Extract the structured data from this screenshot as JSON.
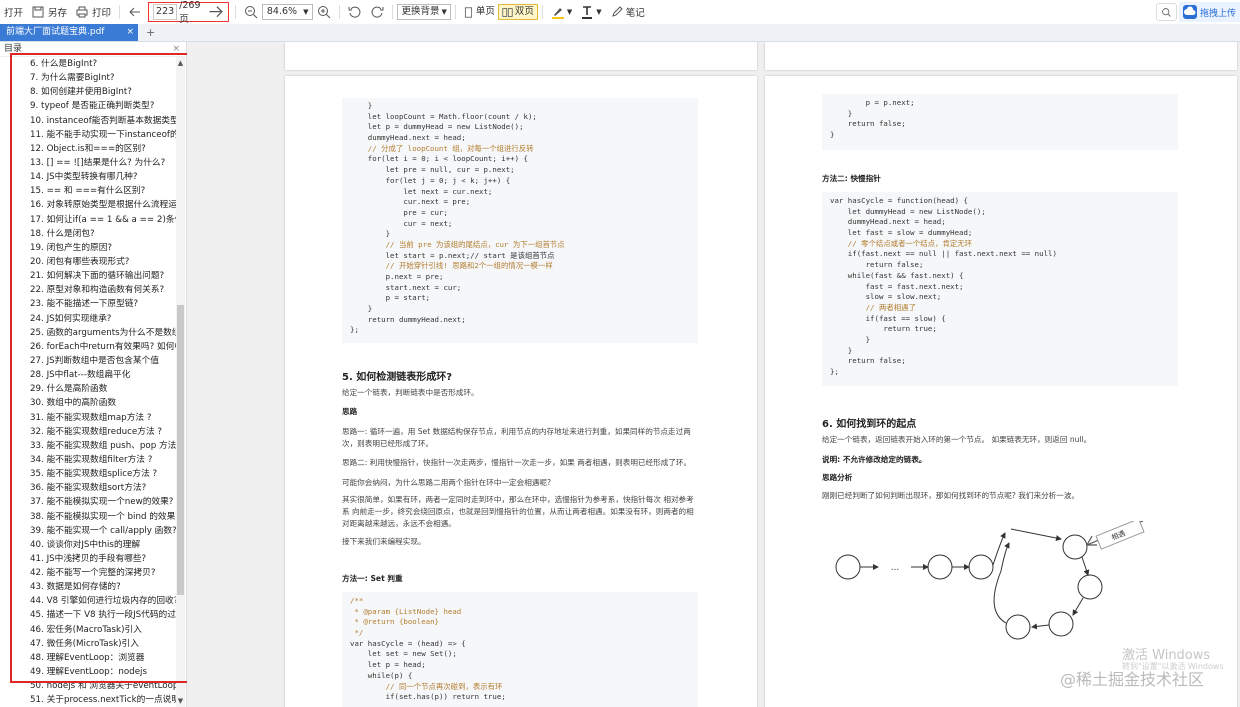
{
  "toolbar": {
    "open": "打开",
    "save_as": "另存",
    "print": "打印",
    "page_current": "223",
    "page_total": "/269页",
    "zoom": "84.6%",
    "background": "更换背景",
    "single": "单页",
    "double": "双页",
    "notes": "笔记",
    "upload": "拖拽上传"
  },
  "tab": {
    "title": "前端大厂面试题宝典.pdf"
  },
  "sidebar": {
    "title": "目录",
    "items": [
      "6. 什么是BigInt?",
      "7. 为什么需要BigInt?",
      "8. 如何创建并使用BigInt?",
      "9. typeof 是否能正确判断类型?",
      "10. instanceof能否判断基本数据类型",
      "11. 能不能手动实现一下instanceof的",
      "12. Object.is和===的区别?",
      "13. [] == ![]结果是什么? 为什么?",
      "14. JS中类型转换有哪几种?",
      "15. == 和 ===有什么区别?",
      "16. 对象转原始类型是根据什么流程运",
      "17. 如何让if(a == 1 && a == 2)条件",
      "18. 什么是闭包?",
      "19. 闭包产生的原因?",
      "20. 闭包有哪些表现形式?",
      "21. 如何解决下面的循环输出问题?",
      "22. 原型对象和构造函数有何关系?",
      "23. 能不能描述一下原型链?",
      "24. JS如何实现继承?",
      "25. 函数的arguments为什么不是数组",
      "26. forEach中return有效果吗? 如何中",
      "27. JS判断数组中是否包含某个值",
      "28. JS中flat---数组扁平化",
      "29. 什么是高阶函数",
      "30. 数组中的高阶函数",
      "31. 能不能实现数组map方法 ?",
      "32. 能不能实现数组reduce方法 ?",
      "33. 能不能实现数组 push、pop 方法",
      "34. 能不能实现数组filter方法 ?",
      "35. 能不能实现数组splice方法 ?",
      "36. 能不能实现数组sort方法?",
      "37. 能不能模拟实现一个new的效果?",
      "38. 能不能模拟实现一个 bind 的效果?",
      "39. 能不能实现一个 call/apply 函数?",
      "40. 谈谈你对JS中this的理解",
      "41. JS中浅拷贝的手段有哪些?",
      "42. 能不能写一个完整的深拷贝?",
      "43. 数据是如何存储的?",
      "44. V8 引擎如何进行垃圾内存的回收?",
      "45. 描述一下 V8 执行一段JS代码的过程",
      "46. 宏任务(MacroTask)引入",
      "47. 微任务(MicroTask)引入",
      "48. 理解EventLoop：浏览器",
      "49. 理解EventLoop：nodejs",
      "50. nodejs 和 浏览器关于eventLoop",
      "51. 关于process.nextTick的一点说明"
    ]
  },
  "left_page": {
    "code1": [
      "    }",
      "    let loopCount = Math.floor(count / k);",
      "    let p = dummyHead = new ListNode();",
      "    dummyHead.next = head;",
      "    // 分成了 loopCount 组，对每一个组进行反转",
      "    for(let i = 0; i < loopCount; i++) {",
      "        let pre = null, cur = p.next;",
      "        for(let j = 0; j < k; j++) {",
      "            let next = cur.next;",
      "            cur.next = pre;",
      "            pre = cur;",
      "            cur = next;",
      "        }",
      "        // 当前 pre 为该组的尾结点，cur 为下一组首节点",
      "        let start = p.next;// start 是该组首节点",
      "        // 开始穿针引线! 思路和2个一组的情况一模一样",
      "        p.next = pre;",
      "        start.next = cur;",
      "        p = start;",
      "    }",
      "    return dummyHead.next;",
      "};"
    ],
    "heading5": "5. 如何检测链表形成环?",
    "p1": "给定一个链表，判断链表中是否形成环。",
    "idea": "思路",
    "p2": "思路一: 循环一遍，用 Set 数据结构保存节点，利用节点的内存地址来进行判重，如果同样的节点走过两次，则表明已经形成了环。",
    "p3": "思路二: 利用快慢指针，快指针一次走两步，慢指针一次走一步，如果 两者相遇，则表明已经形成了环。",
    "p4": "可能你会纳闷，为什么思路二用两个指针在环中一定会相遇呢?",
    "p5": "其实很简单，如果有环，两者一定同时走到环中，那么在环中，选慢指针为参考系，快指针每次 相对参考系 向前走一步，终究会绕回原点，也就是回到慢指针的位置，从而让两者相遇。如果没有环，则两者的相对距离越来越远，永远不会相遇。",
    "p6": "接下来我们来编程实现。",
    "method1": "方法一: Set 判重",
    "code2": [
      "/**",
      " * @param {ListNode} head",
      " * @return {boolean}",
      " */",
      "var hasCycle = (head) => {",
      "    let set = new Set();",
      "    let p = head;",
      "    while(p) {",
      "        // 同一个节点再次碰到，表示有环",
      "        if(set.has(p)) return true;"
    ]
  },
  "right_page": {
    "code1": [
      "        p = p.next;",
      "    }",
      "    return false;",
      "}"
    ],
    "method2": "方法二: 快慢指针",
    "code2": [
      "var hasCycle = function(head) {",
      "    let dummyHead = new ListNode();",
      "    dummyHead.next = head;",
      "    let fast = slow = dummyHead;",
      "    // 零个结点或者一个结点，肯定无环",
      "    if(fast.next == null || fast.next.next == null)",
      "        return false;",
      "    while(fast && fast.next) {",
      "        fast = fast.next.next;",
      "        slow = slow.next;",
      "        // 两者相遇了",
      "        if(fast == slow) {",
      "            return true;",
      "        }",
      "    }",
      "    return false;",
      "};"
    ],
    "heading6": "6. 如何找到环的起点",
    "p1": "给定一个链表，返回链表开始入环的第一个节点。 如果链表无环，则返回 null。",
    "note": "说明: 不允许修改给定的链表。",
    "analysis": "思路分析",
    "p2": "刚刚已经判断了如何判断出现环，那如何找到环的节点呢? 我们来分析一波。",
    "diagram_dots": "...",
    "diagram_label": "相遇"
  },
  "watermark": {
    "activate": "激活 Windows",
    "activate_sub": "转到\"设置\"以激活 Windows",
    "brand": "@稀土掘金技术社区"
  }
}
